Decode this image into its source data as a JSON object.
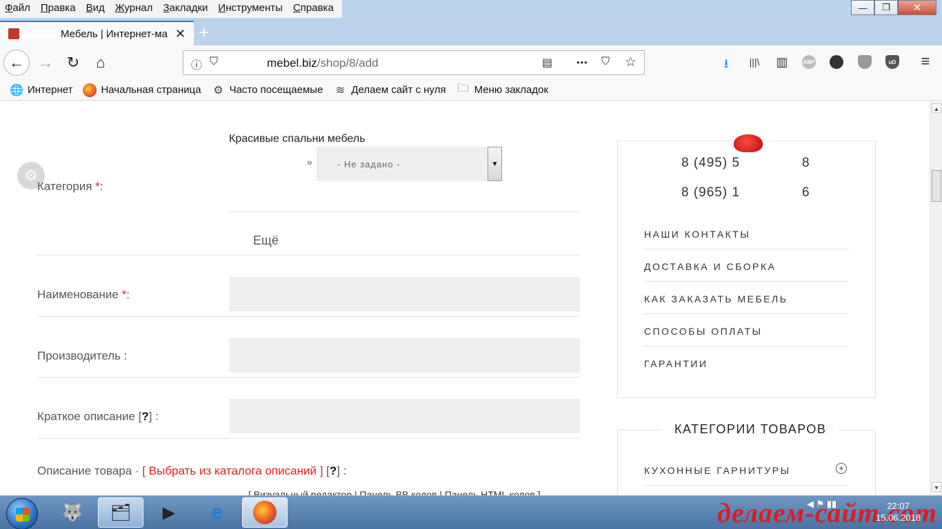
{
  "menubar": {
    "items": [
      {
        "u": "Ф",
        "rest": "айл"
      },
      {
        "u": "П",
        "rest": "равка"
      },
      {
        "u": "В",
        "rest": "ид"
      },
      {
        "u": "Ж",
        "rest": "урнал"
      },
      {
        "u": "З",
        "rest": "акладки"
      },
      {
        "u": "И",
        "rest": "нструменты"
      },
      {
        "u": "С",
        "rest": "правка"
      }
    ]
  },
  "window": {
    "minimize": "—",
    "restore": "❐",
    "close": "✕"
  },
  "tab": {
    "title": "Мебель | Интернет-ма",
    "close": "✕",
    "new_tab": "+"
  },
  "navbar": {
    "back": "←",
    "forward": "→",
    "reload": "↻",
    "home": "⌂",
    "url_host": "mebel.biz",
    "url_path": "/shop/8/add",
    "info_icon": "ⓘ",
    "shield_icon": "⛉",
    "reader_icon": "▤",
    "more_icon": "•••",
    "pocket_icon": "⛉",
    "star_icon": "☆",
    "download_icon": "⭳",
    "library_icon": "|||\\",
    "sidebar_icon": "▥",
    "abp_label": "ABP",
    "ud_label": "uD",
    "menu_icon": "≡"
  },
  "bookmarks": [
    {
      "icon": "globe-icon",
      "glyph": "🌐",
      "label": "Интернет"
    },
    {
      "icon": "firefox-icon",
      "glyph": "",
      "label": "Начальная страница"
    },
    {
      "icon": "gear-icon",
      "glyph": "⚙",
      "label": "Часто посещаемые"
    },
    {
      "icon": "rss-icon",
      "glyph": "≋",
      "label": "Делаем сайт с нуля"
    },
    {
      "icon": "folder-icon",
      "glyph": "🗀",
      "label": "Меню закладок"
    }
  ],
  "form": {
    "category_text": "Красивые спальни мебель",
    "category_label": "Категория ",
    "required_mark": "*",
    "colon": ":",
    "raquo": "»",
    "select_value": "- Не задано -",
    "select_arrow": "▼",
    "more_label": "Ещё",
    "name_label": "Наименование ",
    "manufacturer_label": "Производитель :",
    "short_desc_label": "Краткое описание [",
    "short_desc_q": "?",
    "short_desc_end": "] :",
    "desc_label": "Описание товара · ",
    "desc_link": "[ Выбрать из каталога описаний ]",
    "desc_q_open": " [",
    "desc_q": "?",
    "desc_q_close": "] :",
    "editor_links": "[ Визуальный редактор | Панель BB кодов | Панель HTML кодов ]"
  },
  "sidebar": {
    "phones": [
      {
        "left": "8 (495) 5",
        "right": "8"
      },
      {
        "left": "8 (965) 1",
        "right": "6"
      }
    ],
    "links": [
      "НАШИ КОНТАКТЫ",
      "ДОСТАВКА И СБОРКА",
      "КАК ЗАКАЗАТЬ МЕБЕЛЬ",
      "СПОСОБЫ ОПЛАТЫ",
      "ГАРАНТИИ"
    ],
    "categories_title": "КАТЕГОРИИ ТОВАРОВ",
    "categories": [
      {
        "label": "КУХОННЫЕ ГАРНИТУРЫ",
        "expand": "+"
      }
    ]
  },
  "taskbar": {
    "clock_time": "22:07",
    "clock_date": "15.06.2018",
    "watermark": "делаем-сайт.com"
  }
}
